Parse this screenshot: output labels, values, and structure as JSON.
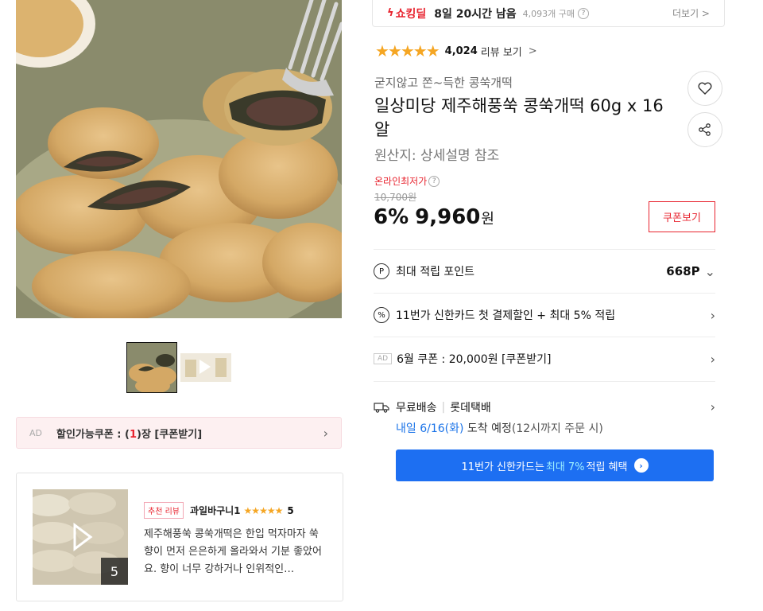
{
  "deal": {
    "icon": "bolt-icon",
    "label": "쇼킹딜",
    "remaining": "8일 20시간 남음",
    "sold": "4,093개 구매",
    "help": "?",
    "more": "더보기 >"
  },
  "rating": {
    "stars": "★★★★★",
    "value": 4.5,
    "count": "4,024",
    "review_link": "리뷰 보기",
    "chevron": ">"
  },
  "product": {
    "subtitle": "굳지않고 쫀~득한 콩쑥개떡",
    "title": "일상미당 제주해풍쑥 콩쑥개떡 60g x 16알",
    "origin": "원산지: 상세설명 참조",
    "lowest_label": "온라인최저가",
    "original_price": "10,700원",
    "discount": "6%",
    "price": "9,960",
    "price_unit": "원"
  },
  "buttons": {
    "coupon": "쿠폰보기",
    "wish": "heart-icon",
    "share": "share-icon"
  },
  "rows": {
    "points": {
      "icon": "P",
      "label": "최대 적립 포인트",
      "value": "668P"
    },
    "card": {
      "icon": "%",
      "label": "11번가 신한카드 첫 결제할인 + 최대 5% 적립"
    },
    "coupon": {
      "ad": "AD",
      "label": "6월 쿠폰 : 20,000원 [쿠폰받기]"
    }
  },
  "shipping": {
    "free": "무료배송",
    "carrier": "롯데택배",
    "date": "내일 6/16(화)",
    "arrive": "도착 예정",
    "note": "(12시까지 주문 시)"
  },
  "card_banner": {
    "prefix": "11번가 신한카드는",
    "highlight": "최대 7%",
    "suffix": "적립 혜택"
  },
  "left_coupon": {
    "ad": "AD",
    "text_a": "할인가능쿠폰 : (",
    "count": "1",
    "text_b": ")장 [쿠폰받기]"
  },
  "review": {
    "badge": "추천 리뷰",
    "user": "과일바구니1",
    "stars": "★★★★★",
    "score": "5",
    "text": "제주해풍쑥 콩쑥개떡은 한입 먹자마자 쑥 향이 먼저 은은하게 올라와서 기분 좋았어요. 향이 너무 강하거나 인위적인…",
    "photo_count": "5"
  },
  "colors": {
    "accent_red": "#e8242f",
    "brand_blue": "#1d6ff2",
    "star": "#f5a623"
  }
}
